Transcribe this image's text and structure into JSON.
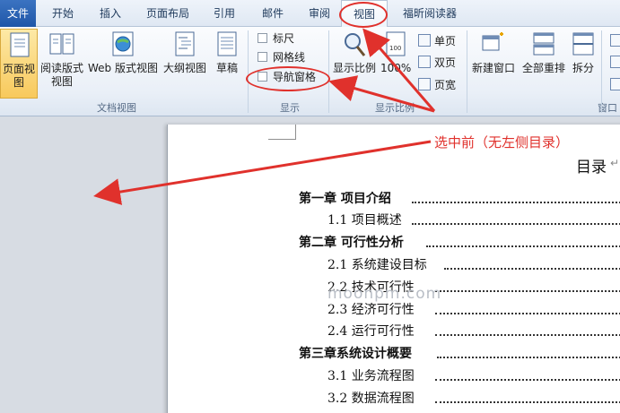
{
  "tabs": [
    {
      "label": "文件"
    },
    {
      "label": "开始"
    },
    {
      "label": "插入"
    },
    {
      "label": "页面布局"
    },
    {
      "label": "引用"
    },
    {
      "label": "邮件"
    },
    {
      "label": "审阅"
    },
    {
      "label": "视图"
    },
    {
      "label": "福昕阅读器"
    }
  ],
  "ribbon": {
    "doc_views": {
      "group_label": "文档视图",
      "buttons": [
        {
          "label": "页面视图"
        },
        {
          "label": "阅读版式\n视图"
        },
        {
          "label": "Web 版式视图"
        },
        {
          "label": "大纲视图"
        },
        {
          "label": "草稿"
        }
      ]
    },
    "show": {
      "group_label": "显示",
      "checkboxes": [
        {
          "label": "标尺",
          "checked": false
        },
        {
          "label": "网格线",
          "checked": false
        },
        {
          "label": "导航窗格",
          "checked": false
        }
      ]
    },
    "zoom": {
      "group_label": "显示比例",
      "zoom_button": "显示比例",
      "hundred_button": "100%",
      "small_buttons": [
        {
          "label": "单页"
        },
        {
          "label": "双页"
        },
        {
          "label": "页宽"
        }
      ]
    },
    "window": {
      "group_label": "窗口",
      "buttons": [
        {
          "label": "新建窗口"
        },
        {
          "label": "全部重排"
        },
        {
          "label": "拆分"
        }
      ]
    }
  },
  "document": {
    "title": "目录",
    "toc": [
      {
        "text": "第一章  项目介绍",
        "level": 1
      },
      {
        "text": "1.1 项目概述",
        "level": 2
      },
      {
        "text": "第二章  可行性分析",
        "level": 1
      },
      {
        "text": "2.1 系统建设目标",
        "level": 2
      },
      {
        "text": "2.2  技术可行性",
        "level": 2
      },
      {
        "text": "2.3  经济可行性",
        "level": 2
      },
      {
        "text": "2.4 运行可行性",
        "level": 2
      },
      {
        "text": "第三章系统设计概要",
        "level": 1
      },
      {
        "text": "3.1 业务流程图",
        "level": 2
      },
      {
        "text": "3.2  数据流程图",
        "level": 2
      }
    ]
  },
  "annotation": {
    "text": "选中前（无左侧目录）",
    "color": "#e0312c"
  },
  "watermark": "moonpm.com",
  "colors": {
    "accent_file_tab": "#2a62b3",
    "ribbon_bg": "#e9eff7",
    "annotation_red": "#e0312c"
  }
}
